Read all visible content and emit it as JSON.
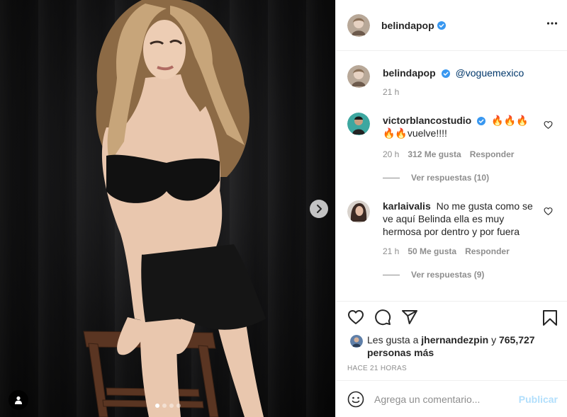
{
  "colors": {
    "verified": "#3897f0",
    "muted": "#8e8e8e",
    "publish_disabled": "#b2dffc",
    "text": "#262626"
  },
  "media": {
    "carousel_count": 4,
    "carousel_active_index": 0
  },
  "header": {
    "username": "belindapop",
    "verified": true,
    "more_icon": "more-horizontal-icon"
  },
  "caption": {
    "username": "belindapop",
    "mention": "@voguemexico",
    "time": "21 h"
  },
  "comments": [
    {
      "username": "victorblancostudio",
      "verified": true,
      "text": "🔥🔥🔥🔥🔥vuelve!!!!",
      "time": "20 h",
      "likes": "312 Me gusta",
      "reply_label": "Responder",
      "view_replies": "Ver respuestas (10)"
    },
    {
      "username": "karlaivalis",
      "verified": false,
      "text": "No me gusta como se ve aquí Belinda ella es muy hermosa por dentro y por fuera",
      "time": "21 h",
      "likes": "50 Me gusta",
      "reply_label": "Responder",
      "view_replies": "Ver respuestas (9)"
    }
  ],
  "likes": {
    "prefix": "Les gusta a",
    "user": "jhernandezpin",
    "joiner": "y",
    "others": "765,727 personas más"
  },
  "timestamp": "HACE 21 HORAS",
  "add_comment": {
    "placeholder": "Agrega un comentario...",
    "publish_label": "Publicar"
  }
}
